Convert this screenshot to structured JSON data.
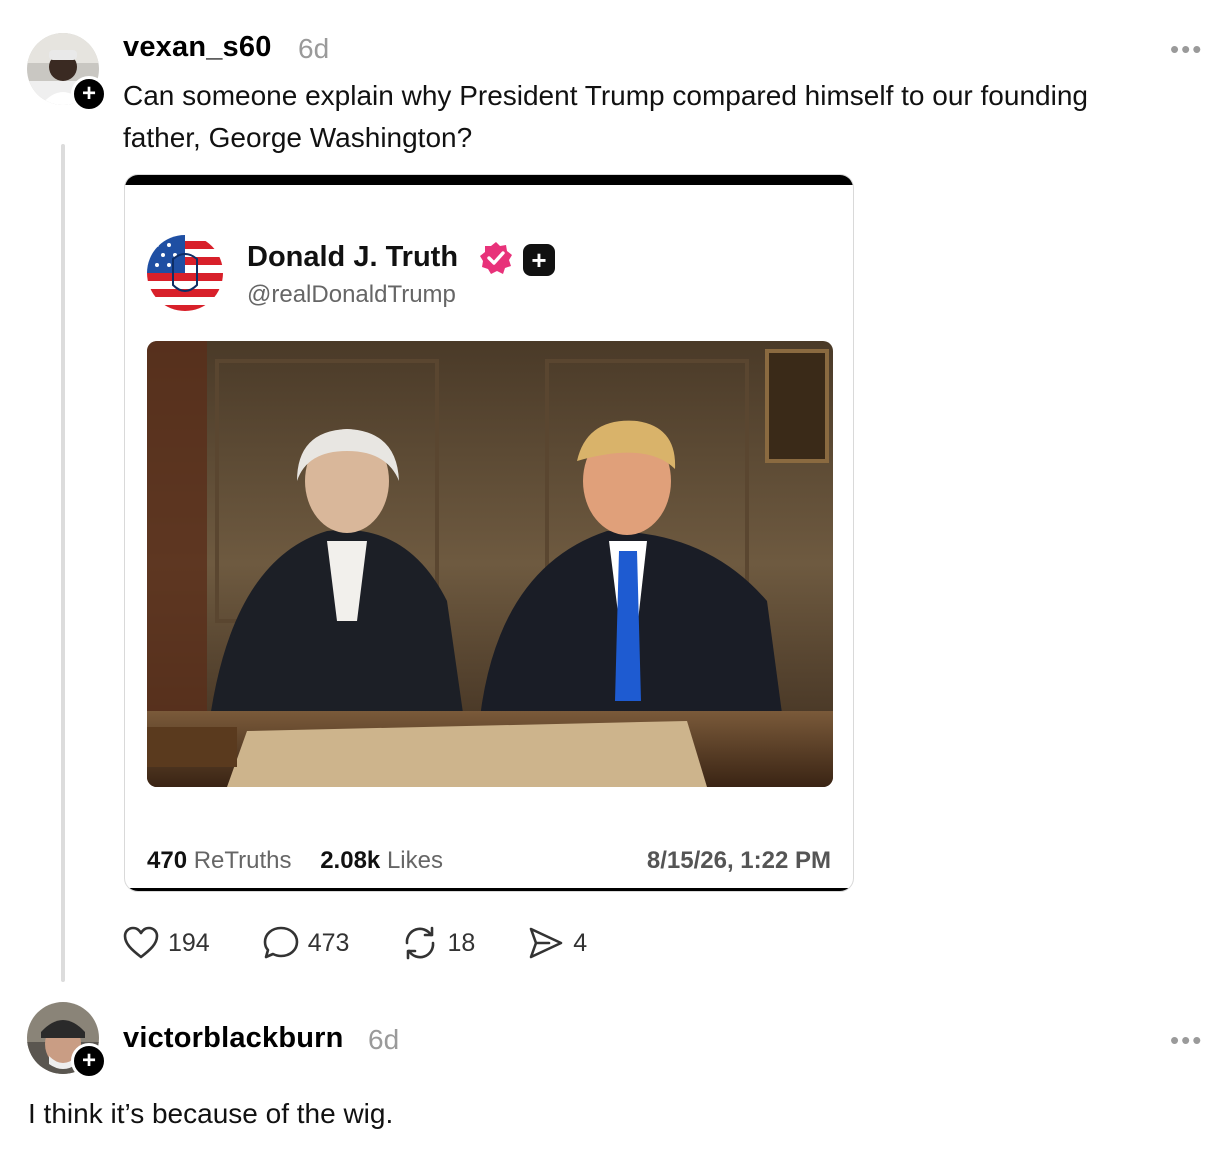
{
  "post": {
    "username": "vexan_s60",
    "time": "6d",
    "text_line1": "Can someone explain why President Trump compared himself to our founding",
    "text_line2": "father, George Washington?",
    "more": "•••",
    "follow": "+",
    "embed": {
      "name": "Donald J. Truth",
      "handle": "@realDonaldTrump",
      "badge": "+",
      "retruths_value": "470",
      "retruths_label": "ReTruths",
      "likes_value": "2.08k",
      "likes_label": "Likes",
      "date": "8/15/26, 1:22 PM"
    },
    "actions": {
      "likes": "194",
      "replies": "473",
      "reposts": "18",
      "shares": "4"
    }
  },
  "reply": {
    "username": "victorblackburn",
    "time": "6d",
    "text": "I think it’s because of the wig.",
    "more": "•••",
    "follow": "+"
  },
  "icons": {
    "like": "heart-icon",
    "reply": "comment-icon",
    "repost": "repost-icon",
    "share": "send-icon",
    "more": "more-dots-icon",
    "verified": "verified-badge-icon"
  },
  "colors": {
    "verified": "#e8327a",
    "meta_gray": "#9a9a9a",
    "thread_line": "#dcdcdc"
  }
}
